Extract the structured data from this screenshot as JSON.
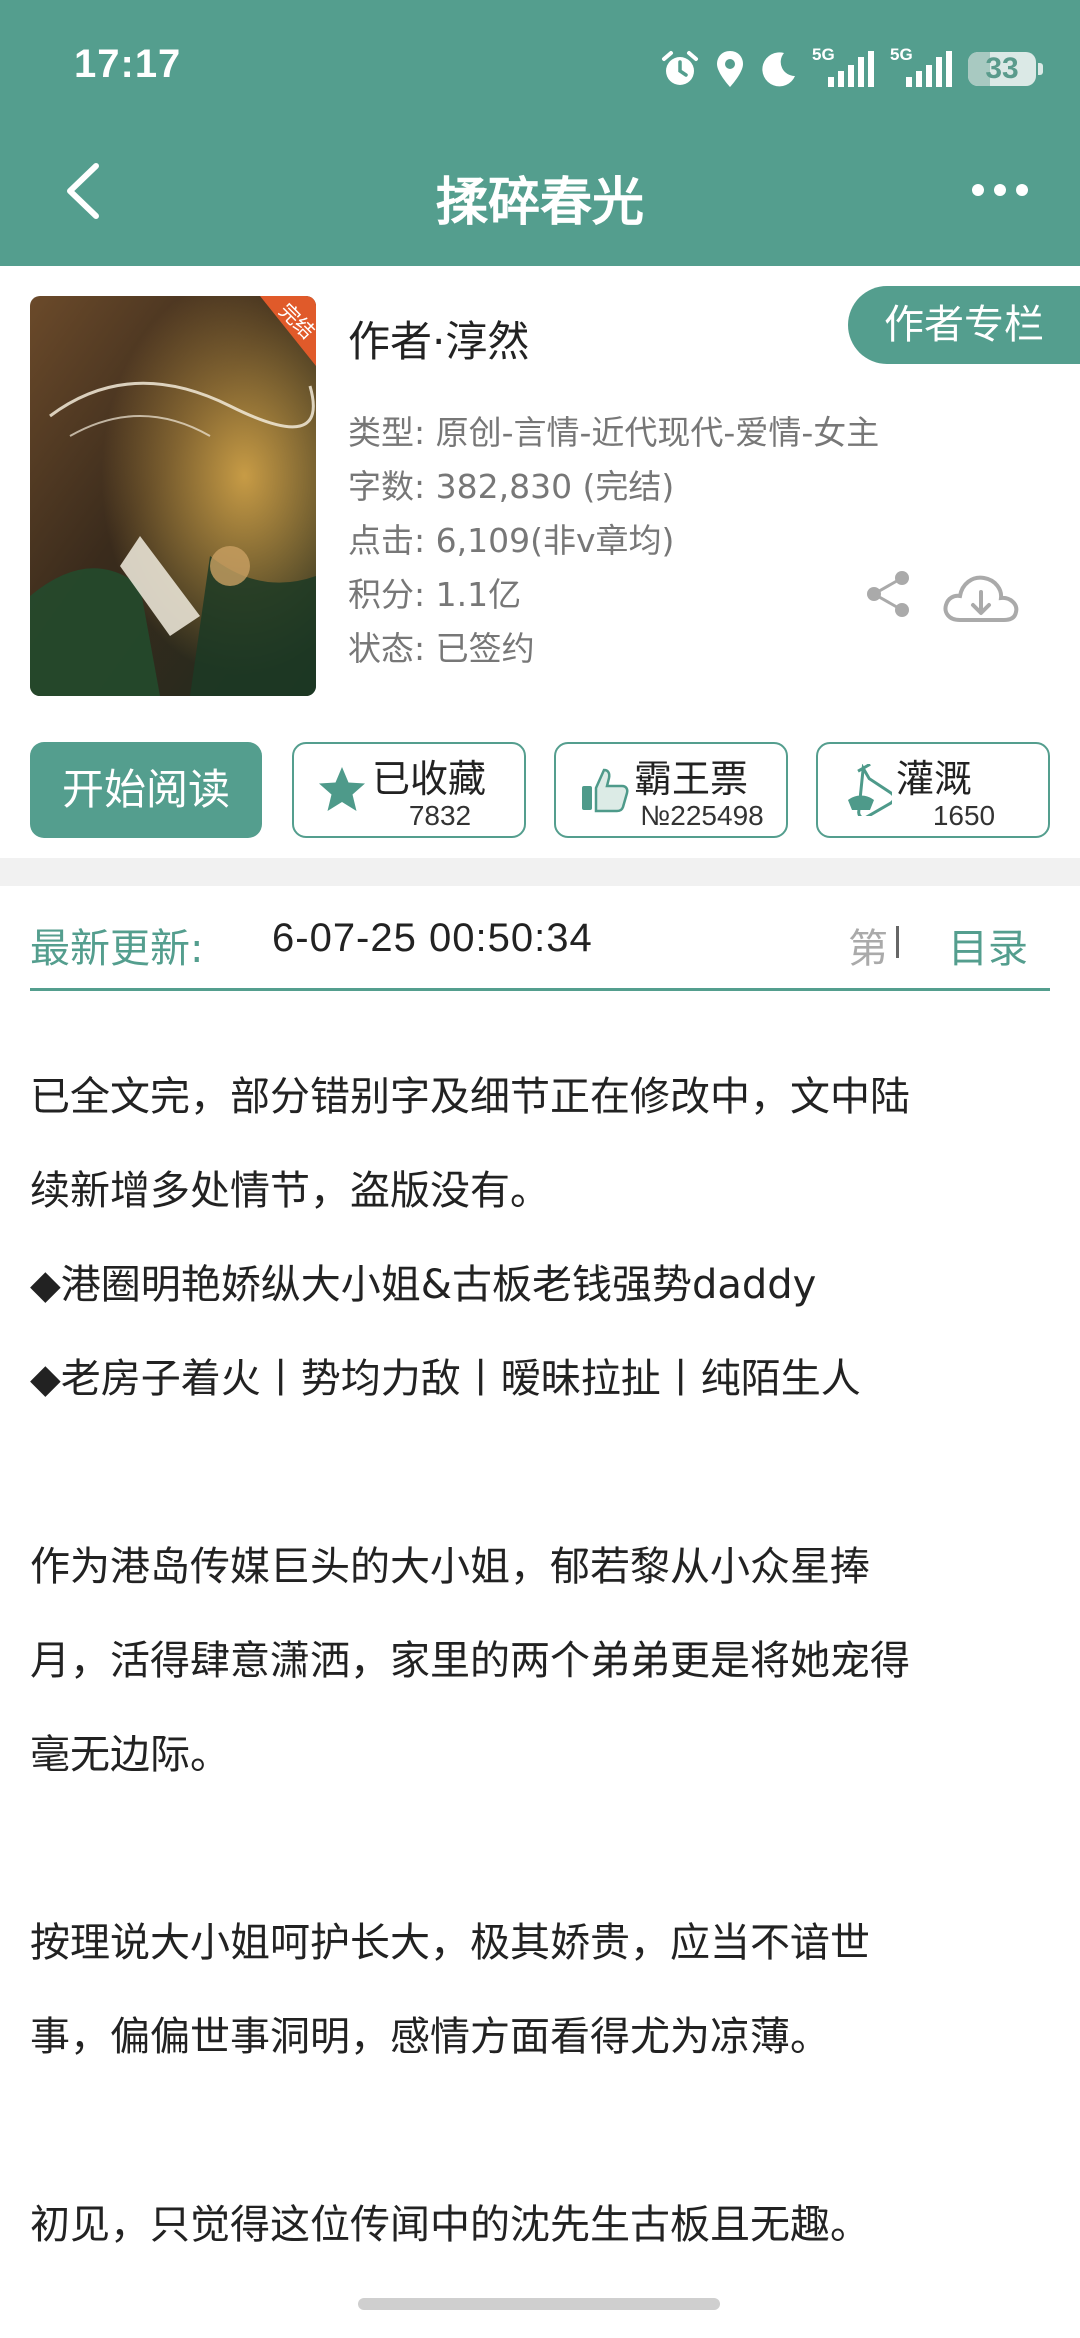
{
  "status_bar": {
    "time": "17:17",
    "network_1": "5G",
    "network_2": "5G",
    "battery": "33",
    "icons": [
      "alarm-icon",
      "location-icon",
      "moon-icon",
      "signal-icon",
      "signal-icon",
      "battery-icon"
    ]
  },
  "header": {
    "title": "揉碎春光",
    "back_icon": "chevron-left-icon",
    "more_icon": "more-horizontal-icon"
  },
  "book": {
    "cover_badge": "完结",
    "author_column_button": "作者专栏",
    "author": "作者·淳然",
    "meta": {
      "type": "类型: 原创-言情-近代现代-爱情-女主",
      "words": "字数: 382,830 (完结)",
      "clicks": "点击: 6,109(非v章均)",
      "score": "积分: 1.1亿",
      "status": "状态: 已签约"
    }
  },
  "actions": {
    "read": "开始阅读",
    "favorite": {
      "label": "已收藏",
      "count": "7832"
    },
    "vote": {
      "label": "霸王票",
      "count": "№225498"
    },
    "nutrient": {
      "label": "灌溉",
      "count": "1650"
    }
  },
  "update": {
    "label": "最新更新:",
    "time": "6-07-25 00:50:34",
    "chapter": "第",
    "toc": "目录"
  },
  "description": [
    "已全文完，部分错别字及细节正在修改中，文中陆",
    "续新增多处情节，盗版没有。",
    "◆港圈明艳娇纵大小姐&古板老钱强势daddy",
    "◆老房子着火丨势均力敌丨暧昧拉扯丨纯陌生人",
    "",
    "作为港岛传媒巨头的大小姐，郁若黎从小众星捧",
    "月，活得肆意潇洒，家里的两个弟弟更是将她宠得",
    "毫无边际。",
    "",
    "按理说大小姐呵护长大，极其娇贵，应当不谙世",
    "事，偏偏世事洞明，感情方面看得尤为凉薄。",
    "",
    "初见，只觉得这位传闻中的沈先生古板且无趣。"
  ],
  "colors": {
    "accent": "#549e8e",
    "muted_text": "#777777"
  }
}
